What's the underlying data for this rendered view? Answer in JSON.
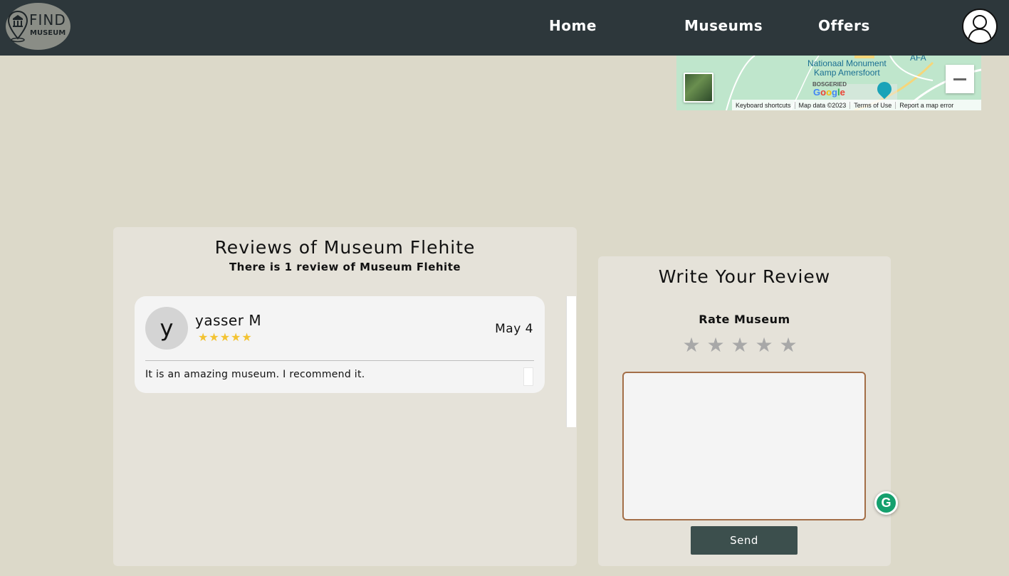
{
  "header": {
    "logo": {
      "line1": "FIND",
      "line2": "MUSEUM"
    },
    "nav": [
      {
        "label": "Home"
      },
      {
        "label": "Museums"
      },
      {
        "label": "Offers"
      }
    ],
    "profile_icon": "user-avatar-icon"
  },
  "map": {
    "place_label_1": "Nationaal Monument",
    "place_label_2": "Kamp Amersfoort",
    "district_label": "BOSGERIED",
    "provider_logo": "Google",
    "top_right_fragment": "AFA",
    "attribution": [
      "Keyboard shortcuts",
      "Map data ©2023",
      "Terms of Use",
      "Report a map error"
    ]
  },
  "reviews": {
    "title": "Reviews of Museum Flehite",
    "subtitle": "There is 1 review of Museum Flehite",
    "items": [
      {
        "initial": "y",
        "name": "yasser M",
        "rating": 5,
        "stars": "★★★★★",
        "date": "May 4",
        "text": "It is an amazing museum. I recommend it."
      }
    ]
  },
  "write_review": {
    "title": "Write Your Review",
    "rate_label": "Rate Museum",
    "rating_stars": [
      "★",
      "★",
      "★",
      "★",
      "★"
    ],
    "textarea_value": "",
    "send_label": "Send"
  },
  "colors": {
    "header_bg": "#2d373b",
    "page_bg": "#dcd9c9",
    "panel_bg": "#e5e2d9",
    "star_filled": "#f3c332",
    "star_empty": "#a8a8a8",
    "send_bg": "#3c4f4d",
    "textarea_border": "#a36e47"
  },
  "grammarly": {
    "glyph": "G"
  }
}
